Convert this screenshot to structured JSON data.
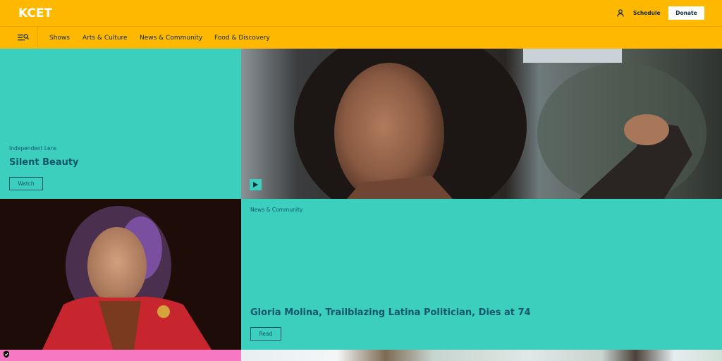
{
  "brand": {
    "logo": "KCET"
  },
  "header": {
    "schedule_label": "Schedule",
    "donate_label": "Donate"
  },
  "nav": {
    "items": [
      "Shows",
      "Arts & Culture",
      "News & Community",
      "Food & Discovery"
    ]
  },
  "hero": {
    "kicker": "Independent Lens",
    "title": "Silent Beauty",
    "button_label": "Watch"
  },
  "feature": {
    "kicker": "News & Community",
    "title": "Gloria Molina, Trailblazing Latina Politician, Dies at 74",
    "button_label": "Read"
  },
  "icons": {
    "menu": "menu-search-icon",
    "user": "user-icon",
    "play": "play-icon",
    "privacy": "shield-check-icon"
  },
  "colors": {
    "header": "#ffb800",
    "teal": "#3ccfbd",
    "text_dark": "#14566a",
    "pink": "#f779c4"
  }
}
